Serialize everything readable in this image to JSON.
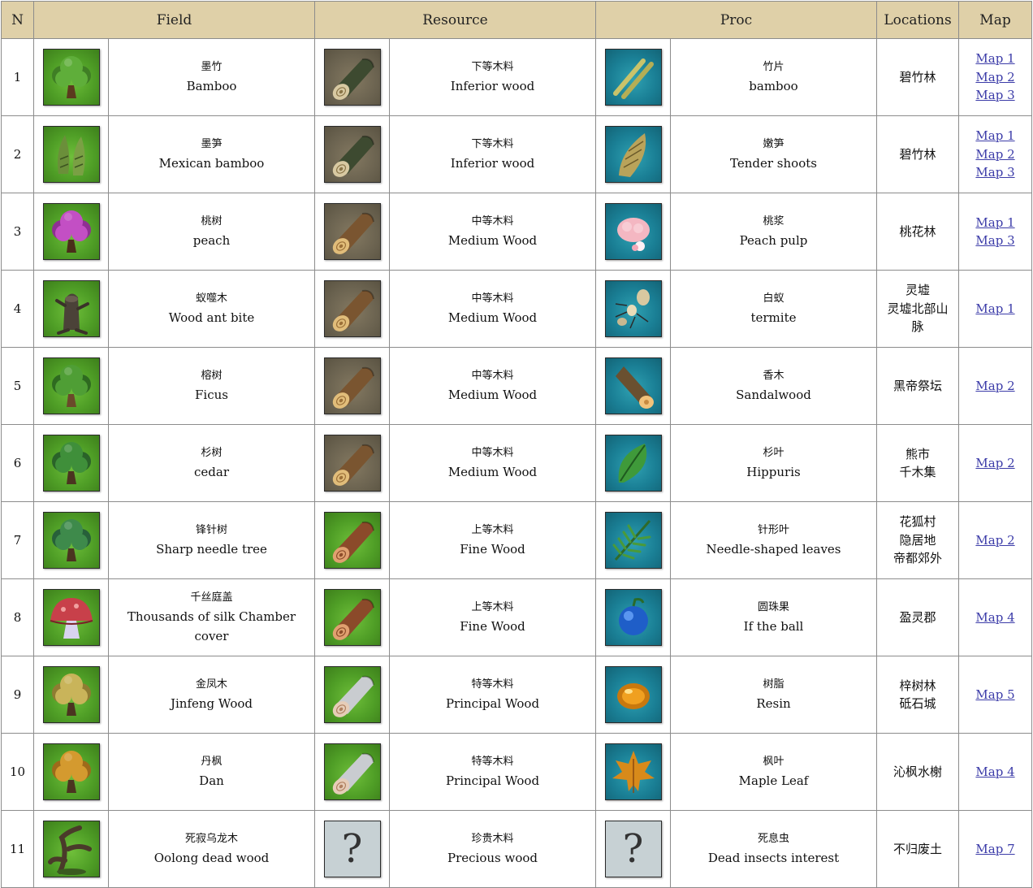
{
  "headers": [
    "N",
    "Field",
    "Resource",
    "Proc",
    "Locations",
    "Map"
  ],
  "rows": [
    {
      "n": "1",
      "field_icon": "tree-icon",
      "field_cn": "墨竹",
      "field_en": "Bamboo",
      "res_icon": "log-inferior-icon",
      "res_cn": "下等木料",
      "res_en": "Inferior wood",
      "proc_icon": "bamboo-slips-icon",
      "proc_cn": "竹片",
      "proc_en": "bamboo",
      "locations": [
        "碧竹林"
      ],
      "maps": [
        "Map 1",
        "Map 2",
        "Map 3"
      ]
    },
    {
      "n": "2",
      "field_icon": "bamboo-shoot-icon",
      "field_cn": "墨笋",
      "field_en": "Mexican bamboo",
      "res_icon": "log-inferior-icon",
      "res_cn": "下等木料",
      "res_en": "Inferior wood",
      "proc_icon": "tender-shoot-icon",
      "proc_cn": "嫩笋",
      "proc_en": "Tender shoots",
      "locations": [
        "碧竹林"
      ],
      "maps": [
        "Map 1",
        "Map 2",
        "Map 3"
      ]
    },
    {
      "n": "3",
      "field_icon": "peach-tree-icon",
      "field_cn": "桃树",
      "field_en": "peach",
      "res_icon": "log-medium-icon",
      "res_cn": "中等木料",
      "res_en": "Medium Wood",
      "proc_icon": "peach-pulp-icon",
      "proc_cn": "桃浆",
      "proc_en": "Peach pulp",
      "locations": [
        "桃花林"
      ],
      "maps": [
        "Map 1",
        "Map 3"
      ]
    },
    {
      "n": "4",
      "field_icon": "dead-stump-icon",
      "field_cn": "蚁噬木",
      "field_en": "Wood ant bite",
      "res_icon": "log-medium-icon",
      "res_cn": "中等木料",
      "res_en": "Medium Wood",
      "proc_icon": "termite-icon",
      "proc_cn": "白蚁",
      "proc_en": "termite",
      "locations": [
        "灵墟",
        "灵墟北部山",
        "脉"
      ],
      "maps": [
        "Map 1"
      ]
    },
    {
      "n": "5",
      "field_icon": "ficus-tree-icon",
      "field_cn": "榕树",
      "field_en": "Ficus",
      "res_icon": "log-medium-icon",
      "res_cn": "中等木料",
      "res_en": "Medium Wood",
      "proc_icon": "sandalwood-icon",
      "proc_cn": "香木",
      "proc_en": "Sandalwood",
      "locations": [
        "黑帝祭坛"
      ],
      "maps": [
        "Map 2"
      ]
    },
    {
      "n": "6",
      "field_icon": "cedar-tree-icon",
      "field_cn": "杉树",
      "field_en": "cedar",
      "res_icon": "log-medium-icon",
      "res_cn": "中等木料",
      "res_en": "Medium Wood",
      "proc_icon": "leaf-icon",
      "proc_cn": "杉叶",
      "proc_en": "Hippuris",
      "locations": [
        "熊市",
        "千木集"
      ],
      "maps": [
        "Map 2"
      ]
    },
    {
      "n": "7",
      "field_icon": "needle-tree-icon",
      "field_cn": "锋针树",
      "field_en": "Sharp needle tree",
      "res_icon": "log-fine-icon",
      "res_cn": "上等木料",
      "res_en": "Fine Wood",
      "proc_icon": "needle-leaves-icon",
      "proc_cn": "针形叶",
      "proc_en": "Needle-shaped leaves",
      "locations": [
        "花狐村",
        "隐居地",
        "帝都郊外"
      ],
      "maps": [
        "Map 2"
      ]
    },
    {
      "n": "8",
      "field_icon": "mushroom-icon",
      "field_cn": "千丝庭盖",
      "field_en": "Thousands of silk Chamber cover",
      "res_icon": "log-fine-icon",
      "res_cn": "上等木料",
      "res_en": "Fine Wood",
      "proc_icon": "blue-fruit-icon",
      "proc_cn": "圆珠果",
      "proc_en": "If the ball",
      "locations": [
        "盈灵郡"
      ],
      "maps": [
        "Map 4"
      ]
    },
    {
      "n": "9",
      "field_icon": "golden-tree-icon",
      "field_cn": "金凤木",
      "field_en": "Jinfeng Wood",
      "res_icon": "log-principal-icon",
      "res_cn": "特等木料",
      "res_en": "Principal Wood",
      "proc_icon": "resin-icon",
      "proc_cn": "树脂",
      "proc_en": "Resin",
      "locations": [
        "梓树林",
        "砥石城"
      ],
      "maps": [
        "Map 5"
      ]
    },
    {
      "n": "10",
      "field_icon": "maple-tree-icon",
      "field_cn": "丹枫",
      "field_en": "Dan",
      "res_icon": "log-principal-icon",
      "res_cn": "特等木料",
      "res_en": "Principal Wood",
      "proc_icon": "maple-leaf-icon",
      "proc_cn": "枫叶",
      "proc_en": "Maple Leaf",
      "locations": [
        "沁枫水榭"
      ],
      "maps": [
        "Map 4"
      ]
    },
    {
      "n": "11",
      "field_icon": "oolong-dead-wood-icon",
      "field_cn": "死寂乌龙木",
      "field_en": "Oolong dead wood",
      "res_icon": "unknown-icon",
      "res_cn": "珍贵木料",
      "res_en": "Precious wood",
      "proc_icon": "unknown-icon",
      "proc_cn": "死息虫",
      "proc_en": "Dead insects interest",
      "locations": [
        "不归废土"
      ],
      "maps": [
        "Map 7"
      ]
    }
  ],
  "unknown_glyph": "?",
  "colors": {
    "header_bg": "#dfd0a8",
    "link": "#3b3ba8",
    "border": "#8c8c8c"
  }
}
